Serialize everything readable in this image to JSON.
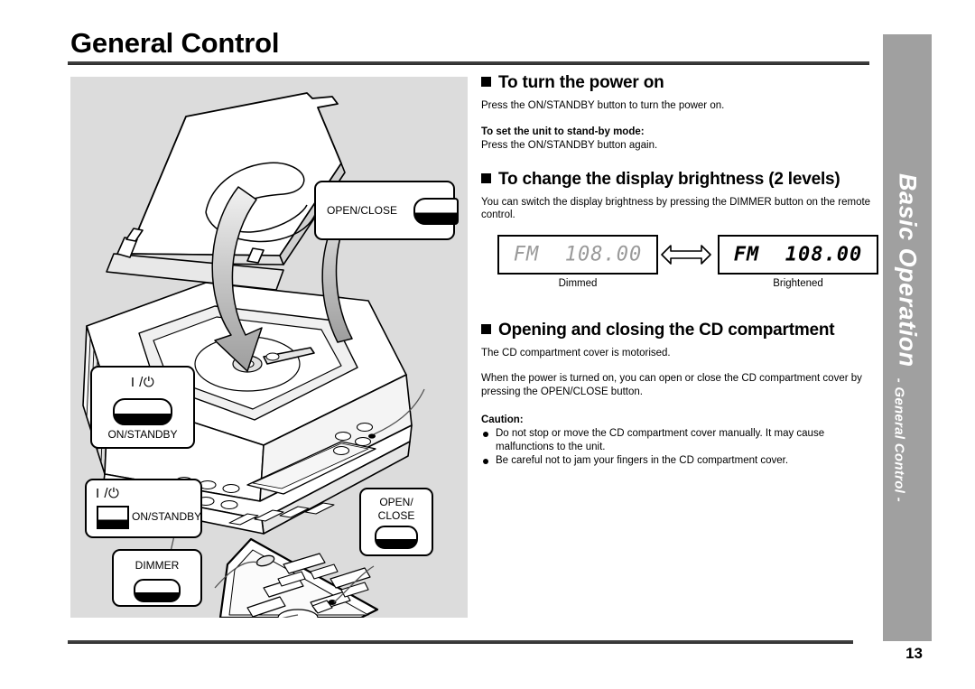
{
  "header": {
    "title": "General Control"
  },
  "side_tab": {
    "main": "Basic Operation",
    "sub": "- General Control -"
  },
  "footer": {
    "page_number": "13"
  },
  "sections": [
    {
      "heading": "To turn the power on",
      "body": "Press the ON/STANDBY button to turn the power on.",
      "sub_heading": "To set the unit to stand-by mode:",
      "sub_body": "Press the ON/STANDBY button again."
    },
    {
      "heading": "To change the display brightness (2 levels)",
      "body": "You can switch the display brightness by pressing the DIMMER button on the remote control."
    },
    {
      "heading": "Opening and closing the CD compartment",
      "body": "The CD compartment cover is motorised.",
      "body2": "When the power is turned on, you can open or close the CD compartment cover by pressing the OPEN/CLOSE button."
    }
  ],
  "display_figure": {
    "dimmed": {
      "text": "FM  108.00",
      "caption": "Dimmed"
    },
    "brightened": {
      "text": "FM  108.00",
      "caption": "Brightened"
    },
    "arrow": "double-arrow-icon"
  },
  "caution": {
    "title": "Caution:",
    "items": [
      "Do not stop or move the CD compartment cover manually. It may cause malfunctions to the unit.",
      "Be careful not to jam your fingers in the CD compartment cover."
    ]
  },
  "illustration": {
    "callouts": {
      "unit_open_close": "OPEN/CLOSE",
      "unit_on_standby": "ON/STANDBY",
      "remote_on_standby": "ON/STANDBY",
      "remote_dimmer": "DIMMER",
      "remote_open_close_line1": "OPEN/",
      "remote_open_close_line2": "CLOSE"
    },
    "power_symbol": "I /",
    "alt": "CD player with motorised lid open, arrows showing open and close motion, plus remote control with callouts"
  },
  "colors": {
    "panel_bg": "#dcdcdc",
    "tab_bg": "#a0a0a0",
    "rule": "#3b3b3b",
    "dimmed_text": "#9a9a9a",
    "arrow_fill": "#b5b5b5"
  }
}
